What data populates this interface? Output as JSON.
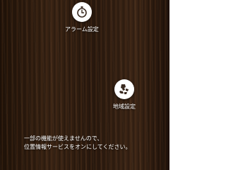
{
  "menu": {
    "alarm": {
      "label": "アラーム設定",
      "icon": "stopwatch-icon"
    },
    "region": {
      "label": "地域設定",
      "icon": "region-map-icon"
    }
  },
  "notice": {
    "line1": "一部の機能が使えませんので、",
    "line2": "位置情報サービスをオンにしてください。"
  },
  "colors": {
    "background": "#2b1a10",
    "icon_bg": "#ffffff",
    "icon_fg": "#3a2a20",
    "text": "#ffffff"
  }
}
